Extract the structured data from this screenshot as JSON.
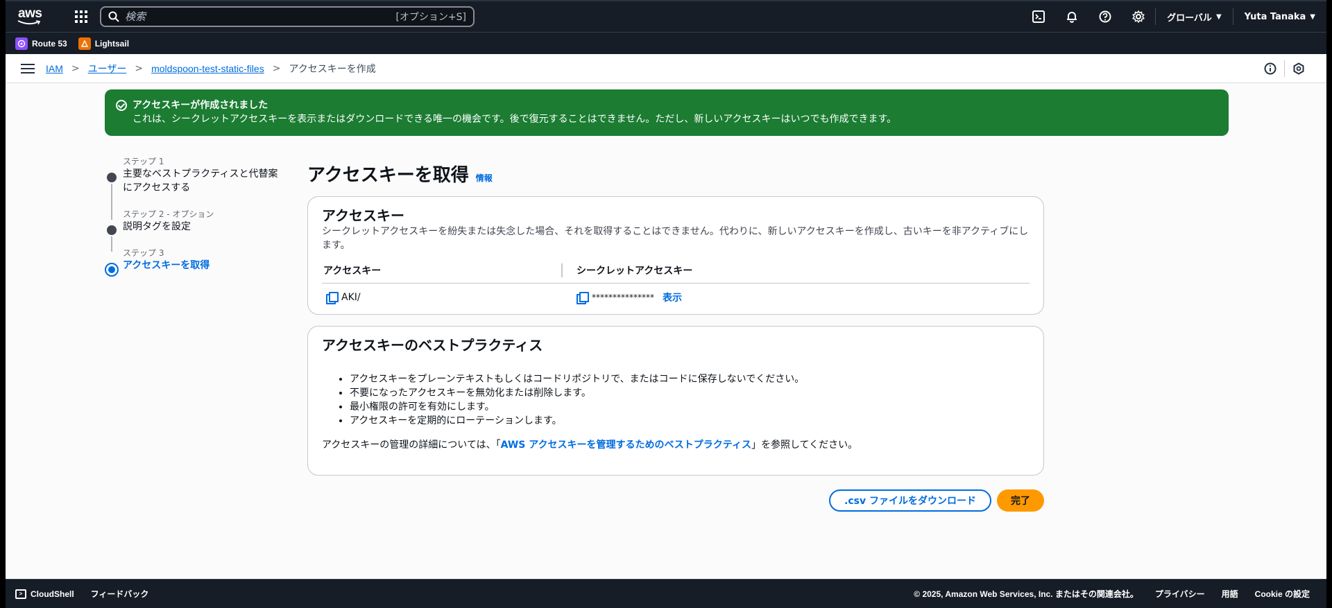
{
  "topnav": {
    "logo_text": "aws",
    "search_placeholder": "検索",
    "search_shortcut": "[オプション+S]",
    "region": "グローバル",
    "user": "Yuta Tanaka"
  },
  "favorites": [
    {
      "label": "Route 53",
      "color": "#8c4fff"
    },
    {
      "label": "Lightsail",
      "color": "#ed7100"
    }
  ],
  "breadcrumb": {
    "items": [
      "IAM",
      "ユーザー",
      "moldspoon-test-static-files"
    ],
    "current": "アクセスキーを作成"
  },
  "flash": {
    "title": "アクセスキーが作成されました",
    "message": "これは、シークレットアクセスキーを表示またはダウンロードできる唯一の機会です。後で復元することはできません。ただし、新しいアクセスキーはいつでも作成できます。"
  },
  "steps": [
    {
      "label": "ステップ 1",
      "name": "主要なベストプラクティスと代替案にアクセスする"
    },
    {
      "label": "ステップ 2 - オプション",
      "name": "説明タグを設定"
    },
    {
      "label": "ステップ 3",
      "name": "アクセスキーを取得"
    }
  ],
  "main": {
    "title": "アクセスキーを取得",
    "info": "情報",
    "access_key_card": {
      "heading": "アクセスキー",
      "description": "シークレットアクセスキーを紛失または失念した場合、それを取得することはできません。代わりに、新しいアクセスキーを作成し、古いキーを非アクティブにします。",
      "col_access_key": "アクセスキー",
      "col_secret": "シークレットアクセスキー",
      "access_key_value": "AKI/",
      "secret_value": "***************",
      "show_label": "表示"
    },
    "best_practices_card": {
      "heading": "アクセスキーのベストプラクティス",
      "items": [
        "アクセスキーをプレーンテキストもしくはコードリポジトリで、またはコードに保存しないでください。",
        "不要になったアクセスキーを無効化または削除します。",
        "最小権限の許可を有効にします。",
        "アクセスキーを定期的にローテーションします。"
      ],
      "footer_prefix": "アクセスキーの管理の詳細については、「",
      "footer_link": "AWS アクセスキーを管理するためのベストプラクティス",
      "footer_suffix": "」を参照してください。"
    },
    "download_button": ".csv ファイルをダウンロード",
    "done_button": "完了"
  },
  "footer": {
    "cloudshell": "CloudShell",
    "feedback": "フィードバック",
    "copyright": "© 2025, Amazon Web Services, Inc. またはその関連会社。",
    "privacy": "プライバシー",
    "terms": "用語",
    "cookie": "Cookie の設定"
  }
}
